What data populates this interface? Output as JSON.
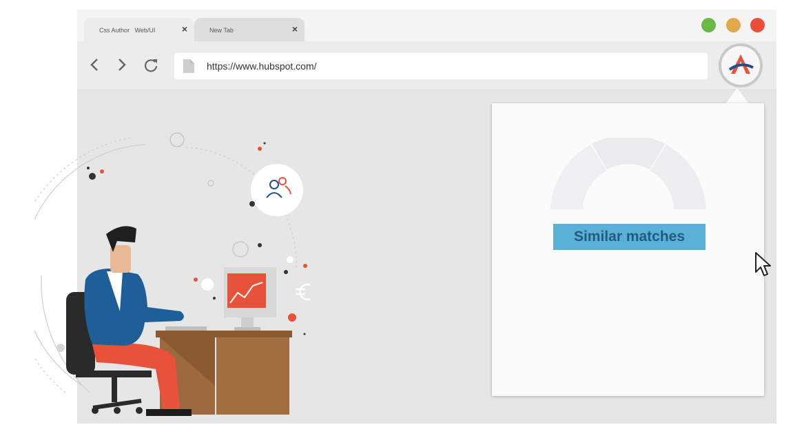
{
  "browser": {
    "tabs": [
      {
        "label": "Css Author   Web/UI",
        "close": "×"
      },
      {
        "label": "New Tab",
        "close": "×"
      }
    ],
    "url": "https://www.hubspot.com/"
  },
  "popup": {
    "button_label": "Similar matches"
  },
  "colors": {
    "close": "#e94f3b",
    "minimize": "#e2a84a",
    "maximize": "#6ab845",
    "accent_blue": "#5ab0d7",
    "brand_red": "#e9523a",
    "brand_navy": "#1f4e8c"
  },
  "icons": [
    "back-icon",
    "forward-icon",
    "reload-icon",
    "page-icon",
    "extension-logo-icon",
    "users-icon",
    "chart-icon",
    "euro-icon",
    "cursor-icon"
  ]
}
